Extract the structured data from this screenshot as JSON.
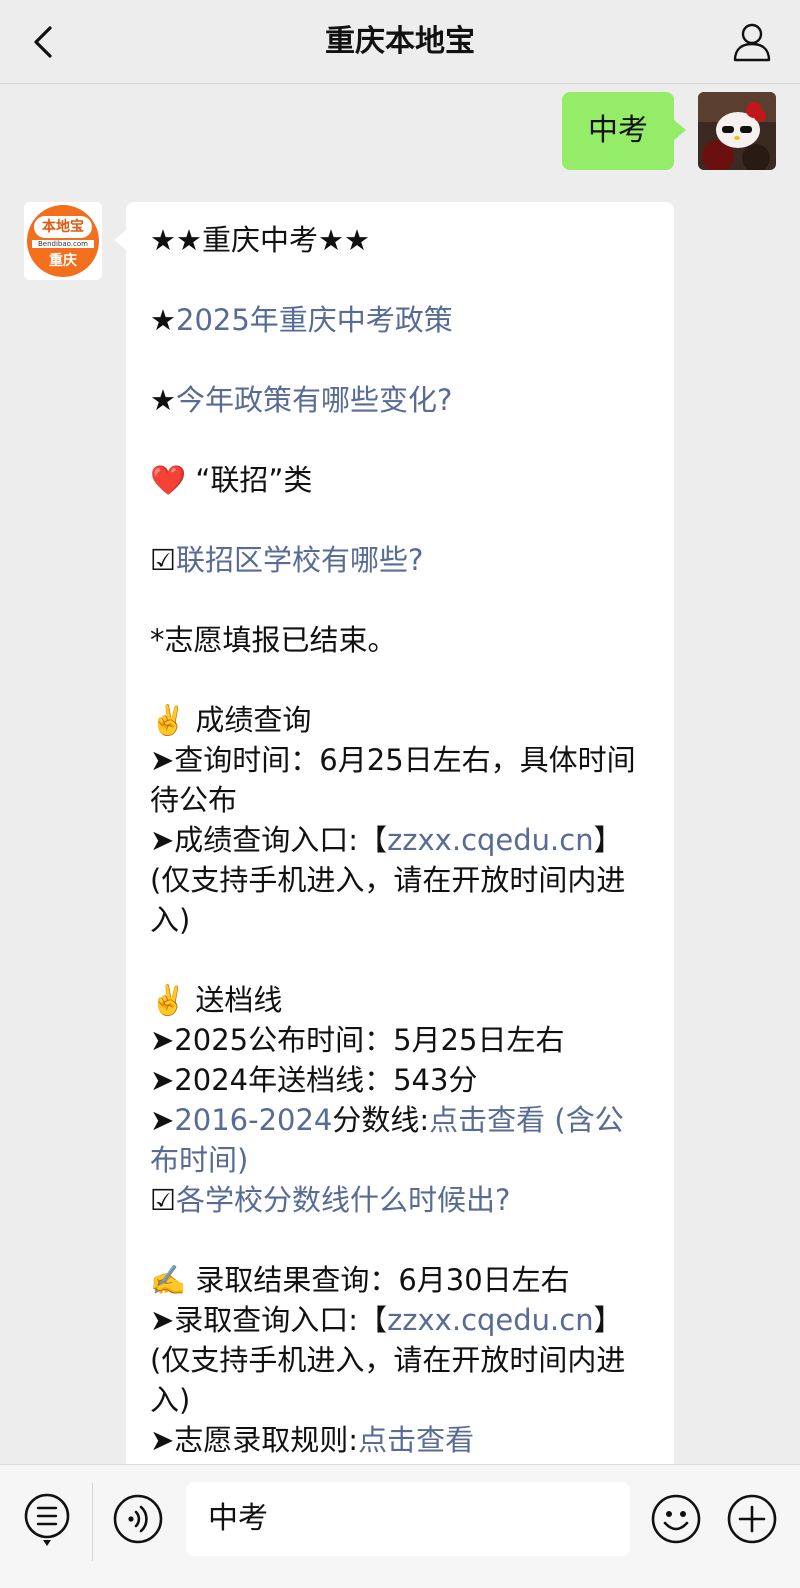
{
  "header": {
    "title": "重庆本地宝",
    "back_icon": "chevron-left-icon",
    "profile_icon": "person-icon"
  },
  "user_message": {
    "text": "中考"
  },
  "bot_avatar": {
    "brand_top": "本地宝",
    "brand_url": "Bendibao.com",
    "brand_city": "重庆"
  },
  "article": {
    "heading": "★★重庆中考★★",
    "star1": "★",
    "policy_link": "2025年重庆中考政策",
    "star2": "★",
    "changes_link": "今年政策有哪些变化?",
    "heart": "❤️",
    "lianzhao": "“联招”类",
    "check1": "☑",
    "schools_link": "联招区学校有哪些?",
    "volunteer_note": "*志愿填报已结束。",
    "score_heading": "✌️ 成绩查询",
    "score_time": "➤查询时间：6月25日左右，具体时间待公布",
    "score_entry_prefix": "➤成绩查询入口:【",
    "score_entry_link": "zzxx.cqedu.cn",
    "score_entry_suffix": "】",
    "score_note": "(仅支持手机进入，请在开放时间内进入)",
    "line_heading": "✌️ 送档线",
    "line_2025": "➤2025公布时间：5月25日左右",
    "line_2024": "➤2024年送档线：543分",
    "hist_prefix": "➤",
    "hist_link": "2016-2024",
    "hist_mid": "分数线:",
    "hist_link2": "点击查看 (含公布时间)",
    "check2": "☑",
    "when_link": "各学校分数线什么时候出?",
    "admit_heading": "✍️ 录取结果查询：6月30日左右",
    "admit_entry_prefix": "➤录取查询入口:【",
    "admit_entry_link": "zzxx.cqedu.cn",
    "admit_entry_suffix": "】",
    "admit_note": "(仅支持手机进入，请在开放时间内进入)",
    "rules_prefix": "➤志愿录取规则:",
    "rules_link": "点击查看"
  },
  "bottom_bar": {
    "input_value": "中考",
    "menu_icon": "list-menu-icon",
    "voice_icon": "voice-icon",
    "emoji_icon": "smiley-icon",
    "plus_icon": "plus-circle-icon"
  },
  "colors": {
    "background": "#ededed",
    "user_bubble": "#95ec69",
    "link": "#576b95",
    "brand_orange": "#f26f1e"
  }
}
